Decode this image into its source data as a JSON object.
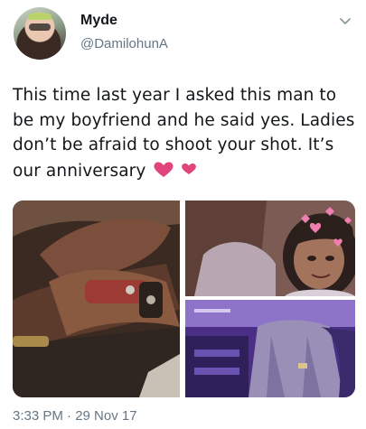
{
  "tweet": {
    "display_name": "Myde",
    "handle": "@DamilohunA",
    "text": "This time last year I asked this man to be my boyfriend and he said yes. Ladies don’t be afraid to shoot your shot. It’s our anniversary",
    "emoji_icon": "two-hearts-icon",
    "timestamp": "3:33 PM · 29 Nov 17",
    "media": [
      {
        "icon": "photo-hands-with-watch"
      },
      {
        "icon": "photo-selfie-couple-hearts-filter"
      },
      {
        "icon": "photo-purple-event-couple"
      }
    ]
  },
  "colors": {
    "text": "#14171a",
    "secondary": "#657786",
    "heart_pink": "#e0457b"
  }
}
